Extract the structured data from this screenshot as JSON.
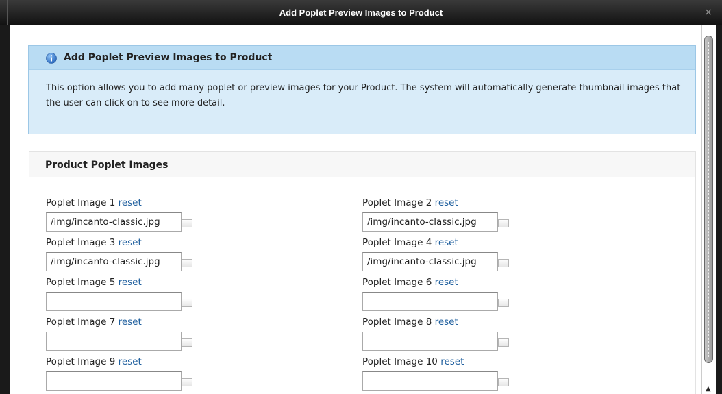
{
  "window": {
    "title": "Add Poplet Preview Images to Product",
    "close_glyph": "×"
  },
  "info": {
    "icon": "info-icon",
    "title": "Add Poplet Preview Images to Product",
    "body": "This option allows you to add many poplet or preview images for your Product. The system will automatically generate thumbnail images that the user can click on to see more detail."
  },
  "section": {
    "title": "Product Poplet Images",
    "reset_label": "reset",
    "fields": [
      {
        "label": "Poplet Image 1",
        "value": "/img/incanto-classic.jpg"
      },
      {
        "label": "Poplet Image 2",
        "value": "/img/incanto-classic.jpg"
      },
      {
        "label": "Poplet Image 3",
        "value": "/img/incanto-classic.jpg"
      },
      {
        "label": "Poplet Image 4",
        "value": "/img/incanto-classic.jpg"
      },
      {
        "label": "Poplet Image 5",
        "value": ""
      },
      {
        "label": "Poplet Image 6",
        "value": ""
      },
      {
        "label": "Poplet Image 7",
        "value": ""
      },
      {
        "label": "Poplet Image 8",
        "value": ""
      },
      {
        "label": "Poplet Image 9",
        "value": ""
      },
      {
        "label": "Poplet Image 10",
        "value": ""
      }
    ]
  },
  "colors": {
    "info_background": "#d9ecf9",
    "link": "#1f5f9e",
    "title_bar": "#1a1a1a"
  }
}
